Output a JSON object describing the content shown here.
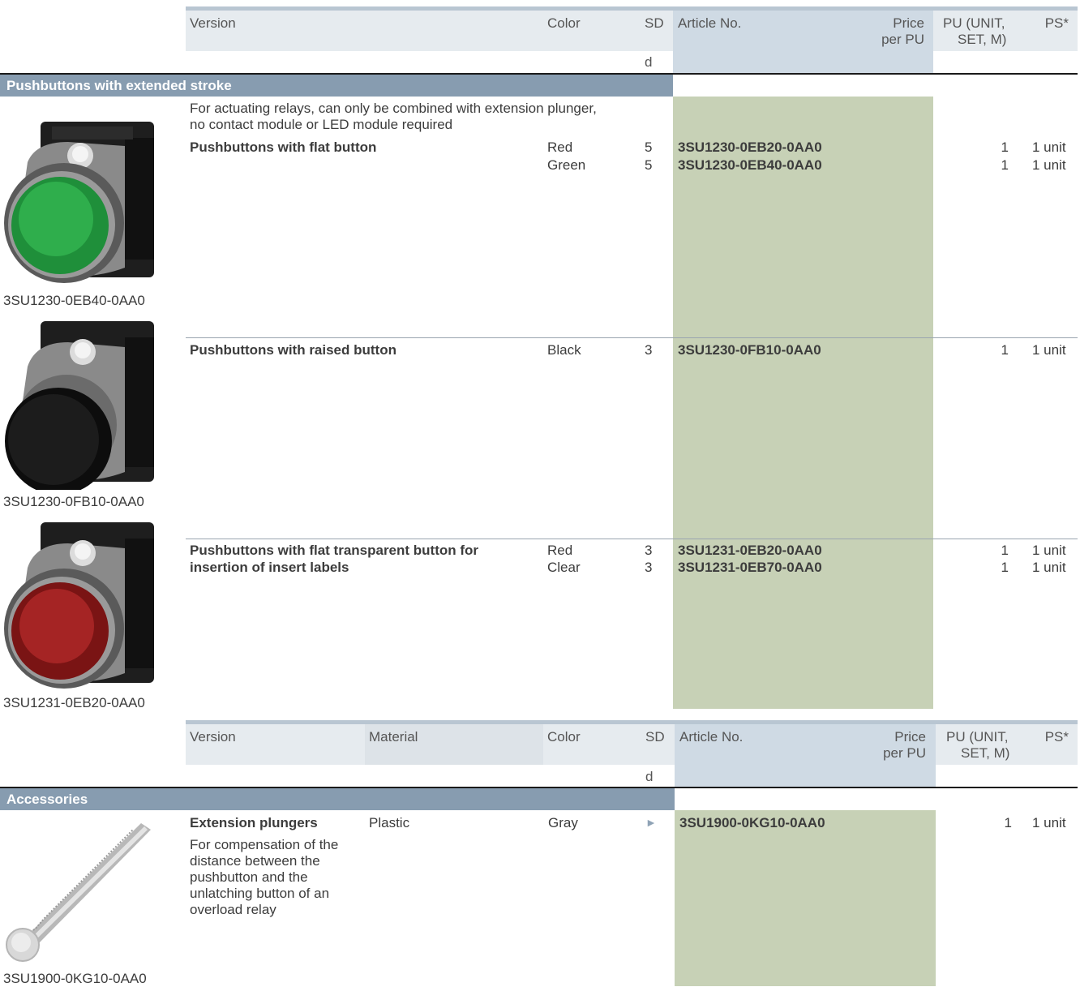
{
  "table1": {
    "headers": {
      "version": "Version",
      "color": "Color",
      "sd": "SD",
      "sd_unit": "d",
      "article": "Article No.",
      "price_1": "Price",
      "price_2": "per PU",
      "pu_1": "PU (UNIT,",
      "pu_2": "SET, M)",
      "ps": "PS*"
    },
    "section_title": "Pushbuttons with extended stroke",
    "intro_line1": "For actuating relays, can only be combined with extension plunger,",
    "intro_line2": "no contact module or LED module required",
    "groups": [
      {
        "title": "Pushbuttons with flat button",
        "image_caption": "3SU1230-0EB40-0AA0",
        "image_icon": "green-flat-pushbutton-image",
        "rows": [
          {
            "color": "Red",
            "sd": "5",
            "article": "3SU1230-0EB20-0AA0",
            "pu": "1",
            "ps": "1 unit"
          },
          {
            "color": "Green",
            "sd": "5",
            "article": "3SU1230-0EB40-0AA0",
            "pu": "1",
            "ps": "1 unit"
          }
        ]
      },
      {
        "title": "Pushbuttons with raised button",
        "image_caption": "3SU1230-0FB10-0AA0",
        "image_icon": "black-raised-pushbutton-image",
        "rows": [
          {
            "color": "Black",
            "sd": "3",
            "article": "3SU1230-0FB10-0AA0",
            "pu": "1",
            "ps": "1 unit"
          }
        ]
      },
      {
        "title_line1": "Pushbuttons with flat transparent button for",
        "title_line2": "insertion of insert labels",
        "image_caption": "3SU1231-0EB20-0AA0",
        "image_icon": "red-transparent-pushbutton-image",
        "rows": [
          {
            "color": "Red",
            "sd": "3",
            "article": "3SU1231-0EB20-0AA0",
            "pu": "1",
            "ps": "1 unit"
          },
          {
            "color": "Clear",
            "sd": "3",
            "article": "3SU1231-0EB70-0AA0",
            "pu": "1",
            "ps": "1 unit"
          }
        ]
      }
    ]
  },
  "table2": {
    "headers": {
      "version": "Version",
      "material": "Material",
      "color": "Color",
      "sd": "SD",
      "sd_unit": "d",
      "article": "Article No.",
      "price_1": "Price",
      "price_2": "per PU",
      "pu_1": "PU (UNIT,",
      "pu_2": "SET, M)",
      "ps": "PS*"
    },
    "section_title": "Accessories",
    "item": {
      "title": "Extension plungers",
      "desc": [
        "For compensation of the",
        "distance between the",
        "pushbutton and the",
        "unlatching button of an",
        "overload relay"
      ],
      "material": "Plastic",
      "color": "Gray",
      "sd_icon": "triangle-right-icon",
      "sd_glyph": "►",
      "article": "3SU1900-0KG10-0AA0",
      "pu": "1",
      "ps": "1 unit",
      "image_caption": "3SU1900-0KG10-0AA0",
      "image_icon": "extension-plunger-image"
    }
  },
  "colors": {
    "header_light": "#e6ebef",
    "header_blue": "#cfdae4",
    "section_bar": "#879cb0",
    "article_column": "#c7d1b6"
  }
}
